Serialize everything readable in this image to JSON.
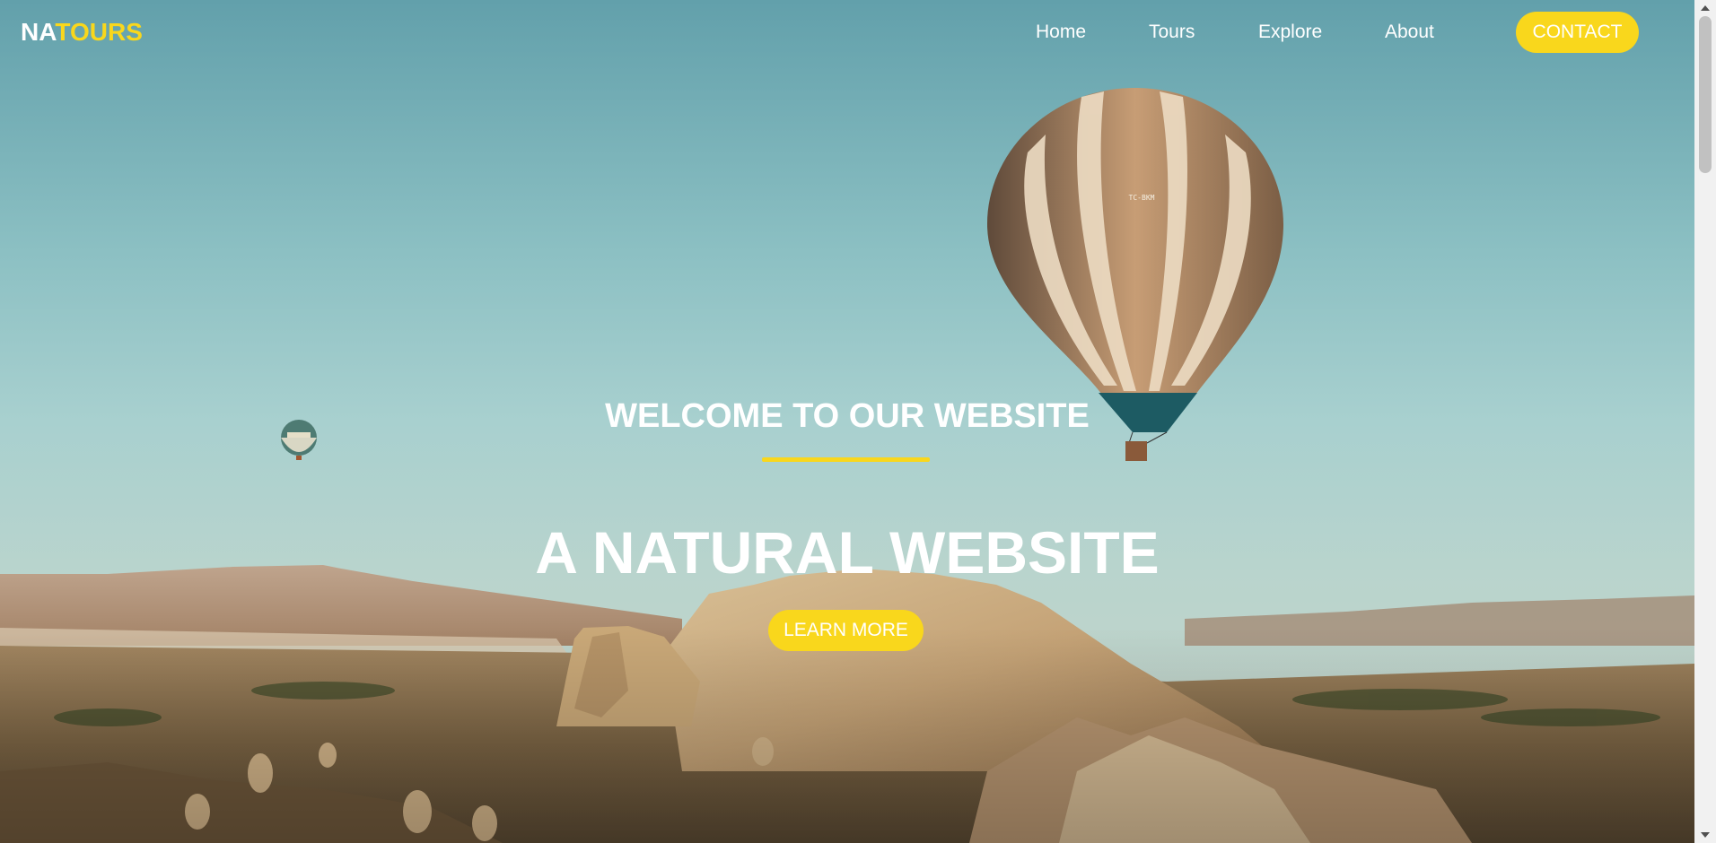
{
  "header": {
    "logo_part1": "NA",
    "logo_part2": "TOURS",
    "nav": [
      {
        "label": "Home"
      },
      {
        "label": "Tours"
      },
      {
        "label": "Explore"
      },
      {
        "label": "About"
      }
    ],
    "contact_label": "CONTACT"
  },
  "hero": {
    "welcome": "WELCOME TO OUR WEBSITE",
    "headline": "A NATURAL WEBSITE",
    "cta_label": "LEARN MORE",
    "balloon_marking": "TC-BKM"
  },
  "colors": {
    "accent": "#f9d71c",
    "text": "#ffffff",
    "sky_top": "#6aa7b0",
    "sky_mid": "#a9d2d2",
    "land": "#b08a5e"
  },
  "icons": {
    "hero_image": "hot-air-balloons-landscape",
    "scrollbar": "scrollbar"
  }
}
